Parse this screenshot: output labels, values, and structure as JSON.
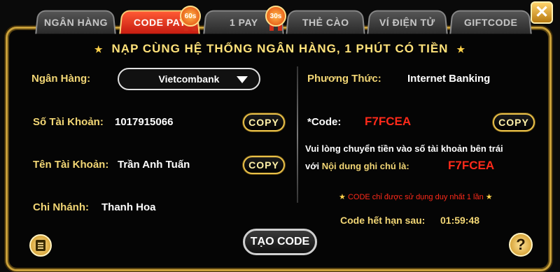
{
  "tabs": [
    {
      "label": "NGÂN HÀNG"
    },
    {
      "label": "CODE PAY",
      "badge": "60s"
    },
    {
      "label": "1 PAY",
      "badge": "30s"
    },
    {
      "label": "THẺ CÀO"
    },
    {
      "label": "VÍ ĐIỆN TỬ"
    },
    {
      "label": "GIFTCODE"
    }
  ],
  "headline": "NẠP CÙNG HỆ THỐNG NGÂN HÀNG, 1 PHÚT CÓ TIỀN",
  "left": {
    "bank_label": "Ngân Hàng:",
    "bank_value": "Vietcombank",
    "account_no_label": "Số Tài Khoản:",
    "account_no_value": "1017915066",
    "account_name_label": "Tên Tài Khoản:",
    "account_name_value": "Trần Anh Tuấn",
    "branch_label": "Chi Nhánh:",
    "branch_value": "Thanh Hoa"
  },
  "right": {
    "method_label": "Phương Thức:",
    "method_value": "Internet Banking",
    "code_label": "*Code:",
    "code_value": "F7FCEA",
    "instruction_line1": "Vui lòng chuyển tiền vào số tài khoản bên trái",
    "instruction_line2_prefix": "với",
    "instruction_line2_label": "Nội dung ghi chú là:",
    "instruction_code": "F7FCEA",
    "warning": "CODE chỉ được sử dụng duy nhất 1 lần",
    "expiry_label": "Code hết hạn sau:",
    "expiry_value": "01:59:48"
  },
  "buttons": {
    "copy": "COPY",
    "generate": "TẠO CODE",
    "close": "✕",
    "help": "?"
  },
  "colors": {
    "gold": "#f2d675",
    "active_tab": "#d8301a",
    "code_red": "#ff2a1a"
  }
}
